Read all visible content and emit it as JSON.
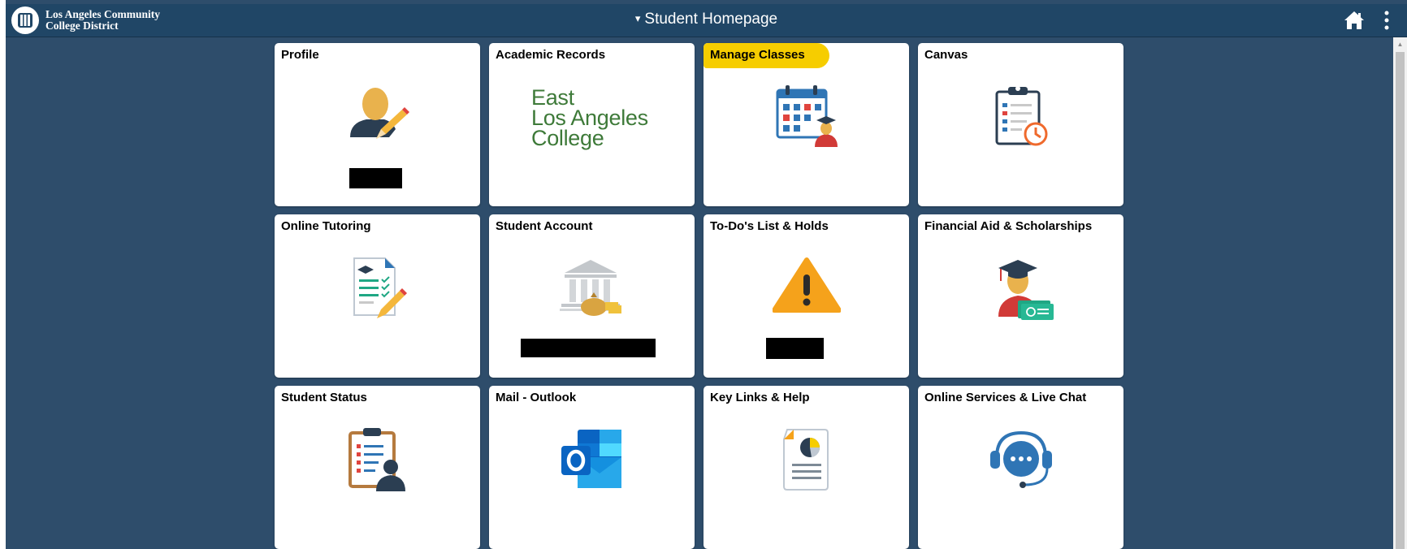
{
  "header": {
    "logo_line1": "Los Angeles Community",
    "logo_line2": "College District",
    "title": "Student Homepage",
    "title_caret": "▾"
  },
  "colors": {
    "page_background": "#2e4d6b",
    "header_background": "#204666",
    "highlight": "#f6cd00",
    "logo_green": "#3e7a39"
  },
  "tiles": [
    {
      "title": "Profile",
      "icon": "user-edit-icon"
    },
    {
      "title": "Academic Records",
      "logo_lines": [
        "East",
        "Los Angeles",
        "College"
      ]
    },
    {
      "title": "Manage Classes",
      "icon": "calendar-student-icon",
      "highlighted": true
    },
    {
      "title": "Canvas",
      "icon": "clipboard-clock-icon"
    },
    {
      "title": "Online Tutoring",
      "icon": "document-checklist-icon"
    },
    {
      "title": "Student Account",
      "icon": "bank-money-icon"
    },
    {
      "title": "To-Do's List & Holds",
      "icon": "warning-icon"
    },
    {
      "title": "Financial Aid & Scholarships",
      "icon": "graduate-money-icon"
    },
    {
      "title": "Student Status",
      "icon": "clipboard-person-icon"
    },
    {
      "title": "Mail - Outlook",
      "icon": "outlook-icon"
    },
    {
      "title": "Key Links & Help",
      "icon": "report-chart-icon"
    },
    {
      "title": "Online Services & Live Chat",
      "icon": "headset-chat-icon"
    }
  ]
}
